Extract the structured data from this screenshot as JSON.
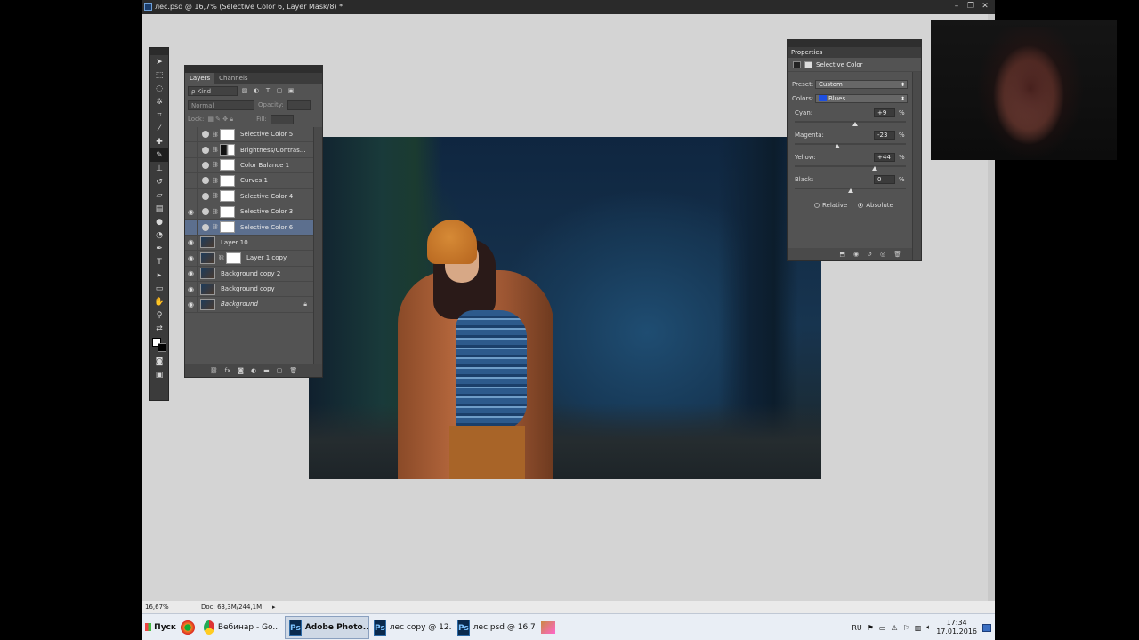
{
  "window": {
    "title": "лес.psd @ 16,7% (Selective Color 6, Layer Mask/8) *",
    "controls": [
      "–",
      "❐",
      "✕"
    ]
  },
  "status": {
    "zoom": "16,67%",
    "doc": "Doc: 63,3M/244,1M"
  },
  "layers_panel": {
    "tabs": [
      "Layers",
      "Channels"
    ],
    "filter_label": "ρ Kind",
    "blend_mode": "Normal",
    "opacity_label": "Opacity:",
    "lock_label": "Lock:",
    "fill_label": "Fill:",
    "layers": [
      {
        "name": "Selective Color 5",
        "visible": false,
        "type": "adjustment"
      },
      {
        "name": "Brightness/Contras...",
        "visible": false,
        "type": "adjustment"
      },
      {
        "name": "Color Balance 1",
        "visible": false,
        "type": "adjustment"
      },
      {
        "name": "Curves 1",
        "visible": false,
        "type": "adjustment"
      },
      {
        "name": "Selective Color 4",
        "visible": false,
        "type": "adjustment"
      },
      {
        "name": "Selective Color 3",
        "visible": true,
        "type": "adjustment"
      },
      {
        "name": "Selective Color 6",
        "visible": false,
        "type": "adjustment",
        "selected": true
      },
      {
        "name": "Layer 10",
        "visible": true,
        "type": "pixel"
      },
      {
        "name": "Layer 1 copy",
        "visible": true,
        "type": "pixel-mask"
      },
      {
        "name": "Background copy 2",
        "visible": true,
        "type": "pixel"
      },
      {
        "name": "Background copy",
        "visible": true,
        "type": "pixel"
      },
      {
        "name": "Background",
        "visible": true,
        "type": "background",
        "locked": true
      }
    ],
    "footer_icons": [
      "link-icon",
      "fx-icon",
      "mask-icon",
      "adjustment-icon",
      "folder-icon",
      "new-layer-icon",
      "trash-icon"
    ]
  },
  "properties_panel": {
    "tab": "Properties",
    "header": "Selective Color",
    "preset_label": "Preset:",
    "preset_value": "Custom",
    "colors_label": "Colors:",
    "colors_value": "Blues",
    "colors_swatch": "#1e4fe0",
    "sliders": [
      {
        "label": "Cyan:",
        "value": "+9",
        "level": 0.545
      },
      {
        "label": "Magenta:",
        "value": "-23",
        "level": 0.385
      },
      {
        "label": "Yellow:",
        "value": "+44",
        "level": 0.72
      },
      {
        "label": "Black:",
        "value": "0",
        "level": 0.5
      }
    ],
    "percent": "%",
    "mode_relative": "Relative",
    "mode_absolute": "Absolute",
    "mode_selected": "Absolute"
  },
  "taskbar": {
    "start": "Пуск",
    "items": [
      {
        "label": "Вебинар - Go...",
        "icon": "chrome-icon",
        "active": false
      },
      {
        "label": "Adobe Photo...",
        "icon": "ps-icon",
        "active": true
      },
      {
        "label": "лес copy @ 12...",
        "icon": "ps-icon",
        "active": false
      },
      {
        "label": "лес.psd @ 16,7...",
        "icon": "ps-icon",
        "active": false
      }
    ],
    "lang": "RU",
    "time": "17:34",
    "date": "17.01.2016"
  },
  "icon_badge": "Ps"
}
